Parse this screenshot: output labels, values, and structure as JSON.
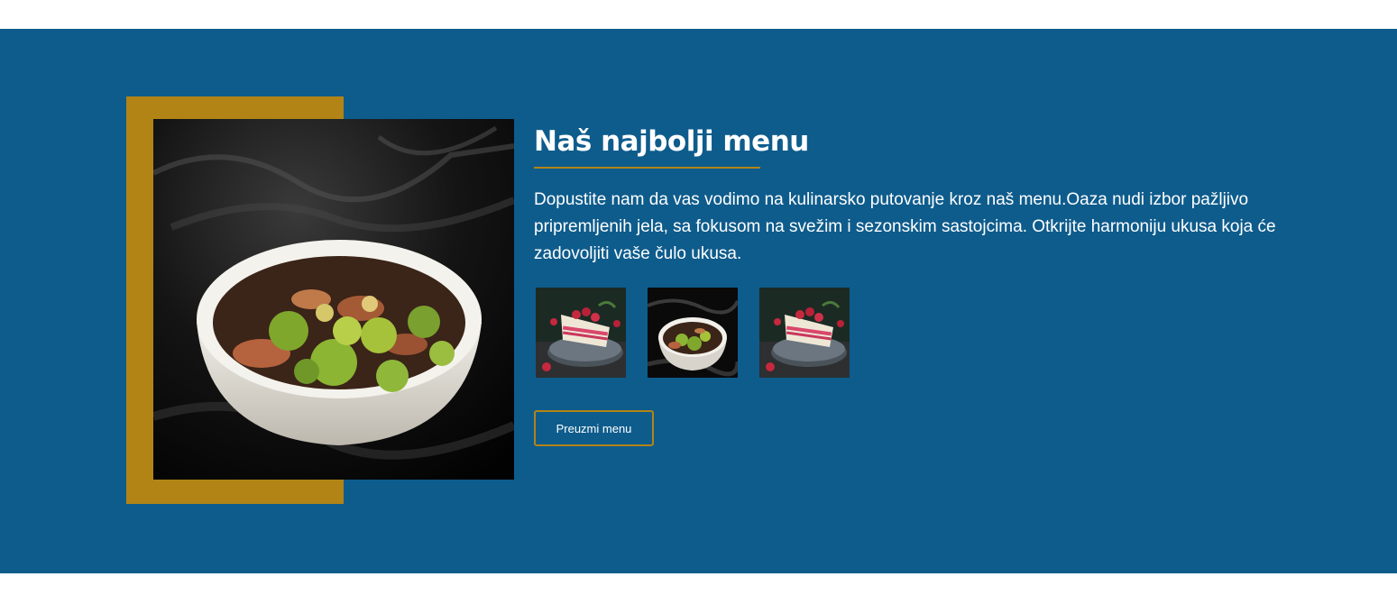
{
  "menu_section": {
    "title": "Naš najbolji menu",
    "description": "Dopustite nam da vas vodimo na kulinarsko putovanje kroz naš menu.Oaza nudi izbor pažljivo pripremljenih jela, sa fokusom na svežim i sezonskim sastojcima. Otkrijte harmoniju ukusa koja će zadovoljiti vaše čulo ukusa.",
    "download_button_label": "Preuzmi menu",
    "main_image": "broccoli-bowl-photo",
    "thumbnails": [
      {
        "image": "raspberry-cake-photo"
      },
      {
        "image": "broccoli-bowl-photo"
      },
      {
        "image": "raspberry-cake-photo"
      }
    ],
    "colors": {
      "background": "#0e5c8c",
      "accent": "#b28416",
      "text": "#ffffff"
    }
  }
}
